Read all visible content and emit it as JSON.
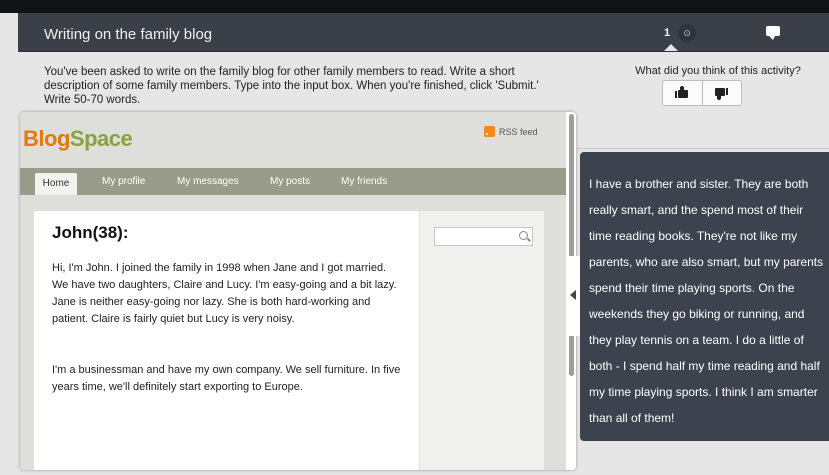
{
  "header": {
    "title": "Writing on the family blog",
    "page_current": "1",
    "page_next_glyph": "⊙",
    "chat_icon": "speech-bubble-icon"
  },
  "instructions": "You've been asked to write on the family blog for other family members to read. Write a short description of some family members. Type into the input box. When you're finished, click 'Submit.' Write 50-70 words.",
  "feedback": {
    "question": "What did you think of this activity?",
    "up_icon": "thumbs-up-icon",
    "down_icon": "thumbs-down-icon"
  },
  "blog": {
    "logo_part1": "Blog",
    "logo_part2": "Space",
    "rss_label": "RSS feed",
    "nav": [
      "Home",
      "My profile",
      "My messages",
      "My posts",
      "My friends"
    ],
    "post": {
      "title": "John(38):",
      "paragraph1": "Hi, I'm John. I joined the family in 1998 when Jane and I got married. We have two daughters, Claire and Lucy. I'm easy-going and a bit lazy. Jane is neither easy-going nor lazy. She is both hard-working and patient. Claire is fairly quiet but Lucy is very noisy.",
      "paragraph2": "I'm a businessman and have my own company. We sell furniture. In five years time, we'll definitely start exporting to Europe."
    },
    "search_value": ""
  },
  "side_text": "I have a brother and sister. They are both really smart, and the spend most of their time reading books. They're not like my parents, who are also smart, but my parents spend their time playing sports. On the weekends they go biking or running, and they play tennis on a team. I do a little of both - I spend half my time reading and half my time playing sports. I think I am smarter than all of them!",
  "colors": {
    "header_bg": "#3b4048",
    "dark_panel_bg": "#3c434e",
    "logo_blog": "#e07a10",
    "logo_space": "#89a23f",
    "nav_bg": "#999c8a"
  }
}
